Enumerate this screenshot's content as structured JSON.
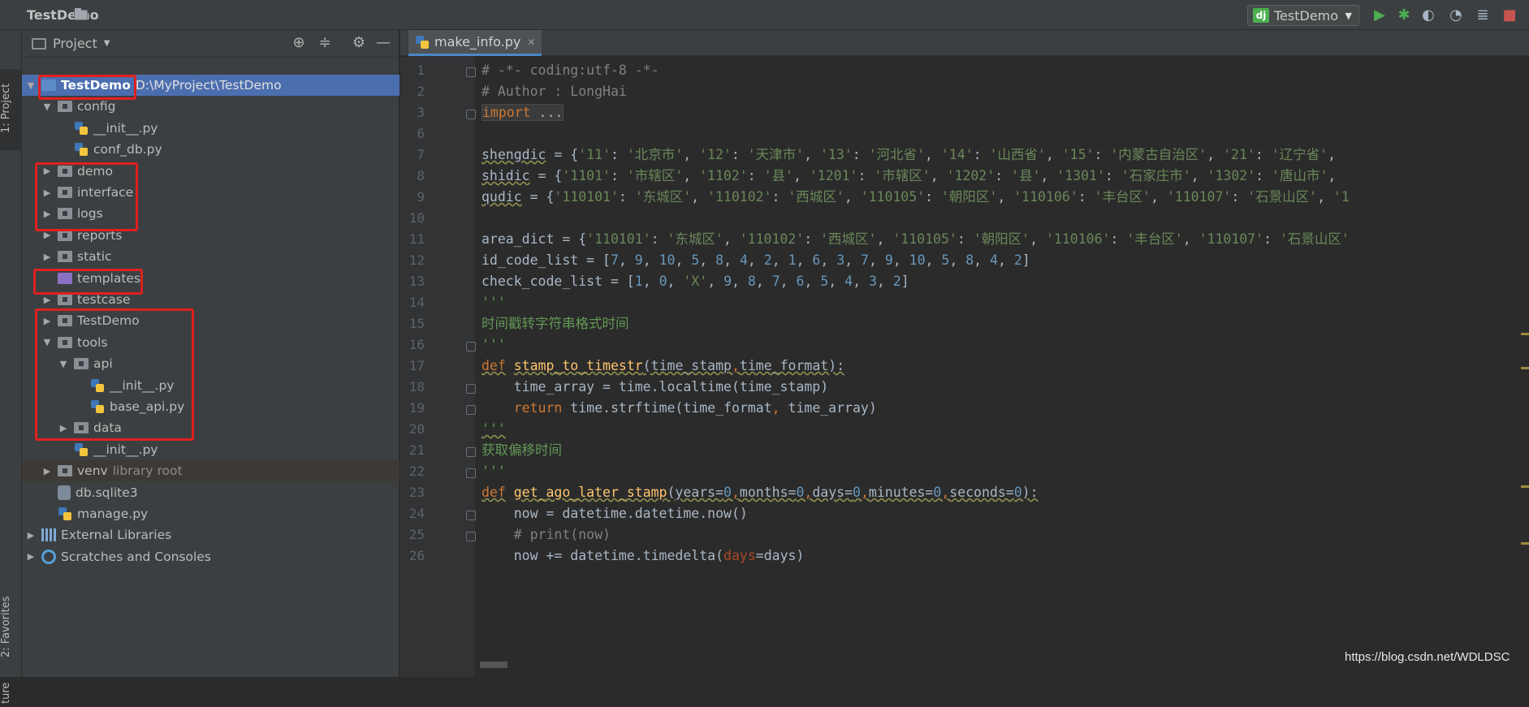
{
  "breadcrumb": {
    "project": "TestDemo"
  },
  "run_config": {
    "icon": "dj",
    "name": "TestDemo"
  },
  "toolbar": {
    "run": {
      "icon": "run-icon",
      "color": "#4caf50"
    },
    "debug": {
      "icon": "debug-icon",
      "color": "#4caf50"
    },
    "coverage": {
      "icon": "coverage-icon"
    },
    "profile": {
      "icon": "profile-icon"
    },
    "concurrency": {
      "icon": "concurrency-icon"
    },
    "stop": {
      "icon": "stop-icon",
      "color": "#c75450"
    }
  },
  "side_tabs": {
    "project": "1: Project",
    "favorites": "2: Favorites",
    "structure": "ture"
  },
  "project_panel": {
    "title": "Project",
    "tree": [
      {
        "label": "TestDemo",
        "sub": "D:\\MyProject\\TestDemo",
        "depth": 0,
        "open": true,
        "type": "module",
        "selected": true
      },
      {
        "label": "config",
        "depth": 1,
        "open": true,
        "type": "folder"
      },
      {
        "label": "__init__.py",
        "depth": 2,
        "type": "py"
      },
      {
        "label": "conf_db.py",
        "depth": 2,
        "type": "py"
      },
      {
        "label": "demo",
        "depth": 1,
        "open": false,
        "type": "folder"
      },
      {
        "label": "interface",
        "depth": 1,
        "open": false,
        "type": "folder"
      },
      {
        "label": "logs",
        "depth": 1,
        "open": false,
        "type": "folder"
      },
      {
        "label": "reports",
        "depth": 1,
        "open": false,
        "type": "folder"
      },
      {
        "label": "static",
        "depth": 1,
        "open": false,
        "type": "folder"
      },
      {
        "label": "templates",
        "depth": 1,
        "type": "template"
      },
      {
        "label": "testcase",
        "depth": 1,
        "open": false,
        "type": "folder"
      },
      {
        "label": "TestDemo",
        "depth": 1,
        "open": false,
        "type": "folder"
      },
      {
        "label": "tools",
        "depth": 1,
        "open": true,
        "type": "folder"
      },
      {
        "label": "api",
        "depth": 2,
        "open": true,
        "type": "folder"
      },
      {
        "label": "__init__.py",
        "depth": 3,
        "type": "py"
      },
      {
        "label": "base_api.py",
        "depth": 3,
        "type": "py"
      },
      {
        "label": "data",
        "depth": 2,
        "open": false,
        "type": "folder"
      },
      {
        "label": "__init__.py",
        "depth": 2,
        "type": "py"
      },
      {
        "label": "venv",
        "sub": "library root",
        "depth": 1,
        "open": false,
        "type": "folder",
        "venv": true
      },
      {
        "label": "db.sqlite3",
        "depth": 1,
        "type": "db"
      },
      {
        "label": "manage.py",
        "depth": 1,
        "type": "py"
      },
      {
        "label": "External Libraries",
        "depth": 0,
        "open": false,
        "type": "lib"
      },
      {
        "label": "Scratches and Consoles",
        "depth": 0,
        "open": false,
        "type": "scratch"
      }
    ]
  },
  "editor": {
    "tab": "make_info.py",
    "lines": [
      {
        "n": "1",
        "html": "<span class=\"c-com\"># -*- coding:utf-8 -*-</span>"
      },
      {
        "n": "2",
        "html": "<span class=\"c-com\"># Author : LongHai</span>"
      },
      {
        "n": "3",
        "html": "<span class=\"imp\"><span class=\"c-kw\">import</span> ...</span>"
      },
      {
        "n": "6",
        "html": ""
      },
      {
        "n": "7",
        "html": "<span class=\"wavy\">shengdic</span> = {<span class=\"c-str\">'11'</span>: <span class=\"c-str\">'北京市'</span>, <span class=\"c-str\">'12'</span>: <span class=\"c-str\">'天津市'</span>, <span class=\"c-str\">'13'</span>: <span class=\"c-str\">'河北省'</span>, <span class=\"c-str\">'14'</span>: <span class=\"c-str\">'山西省'</span>, <span class=\"c-str\">'15'</span>: <span class=\"c-str\">'内蒙古自治区'</span>, <span class=\"c-str\">'21'</span>: <span class=\"c-str\">'辽宁省'</span>,"
      },
      {
        "n": "8",
        "html": "<span class=\"wavy\">shidic</span> = {<span class=\"c-str\">'1101'</span>: <span class=\"c-str\">'市辖区'</span>, <span class=\"c-str\">'1102'</span>: <span class=\"c-str\">'县'</span>, <span class=\"c-str\">'1201'</span>: <span class=\"c-str\">'市辖区'</span>, <span class=\"c-str\">'1202'</span>: <span class=\"c-str\">'县'</span>, <span class=\"c-str\">'1301'</span>: <span class=\"c-str\">'石家庄市'</span>, <span class=\"c-str\">'1302'</span>: <span class=\"c-str\">'唐山市'</span>,"
      },
      {
        "n": "9",
        "html": "<span class=\"wavy\">qudic</span> = {<span class=\"c-str\">'110101'</span>: <span class=\"c-str\">'东城区'</span>, <span class=\"c-str\">'110102'</span>: <span class=\"c-str\">'西城区'</span>, <span class=\"c-str\">'110105'</span>: <span class=\"c-str\">'朝阳区'</span>, <span class=\"c-str\">'110106'</span>: <span class=\"c-str\">'丰台区'</span>, <span class=\"c-str\">'110107'</span>: <span class=\"c-str\">'石景山区'</span>, <span class=\"c-str\">'1</span>"
      },
      {
        "n": "10",
        "html": ""
      },
      {
        "n": "11",
        "html": "area_dict = {<span class=\"c-str\">'110101'</span>: <span class=\"c-str\">'东城区'</span>, <span class=\"c-str\">'110102'</span>: <span class=\"c-str\">'西城区'</span>, <span class=\"c-str\">'110105'</span>: <span class=\"c-str\">'朝阳区'</span>, <span class=\"c-str\">'110106'</span>: <span class=\"c-str\">'丰台区'</span>, <span class=\"c-str\">'110107'</span>: <span class=\"c-str\">'石景山区'</span>"
      },
      {
        "n": "12",
        "html": "id_code_list = [<span class=\"c-num\">7</span>, <span class=\"c-num\">9</span>, <span class=\"c-num\">10</span>, <span class=\"c-num\">5</span>, <span class=\"c-num\">8</span>, <span class=\"c-num\">4</span>, <span class=\"c-num\">2</span>, <span class=\"c-num\">1</span>, <span class=\"c-num\">6</span>, <span class=\"c-num\">3</span>, <span class=\"c-num\">7</span>, <span class=\"c-num\">9</span>, <span class=\"c-num\">10</span>, <span class=\"c-num\">5</span>, <span class=\"c-num\">8</span>, <span class=\"c-num\">4</span>, <span class=\"c-num\">2</span>]"
      },
      {
        "n": "13",
        "html": "check_code_list = [<span class=\"c-num\">1</span>, <span class=\"c-num\">0</span>, <span class=\"c-str\">'X'</span>, <span class=\"c-num\">9</span>, <span class=\"c-num\">8</span>, <span class=\"c-num\">7</span>, <span class=\"c-num\">6</span>, <span class=\"c-num\">5</span>, <span class=\"c-num\">4</span>, <span class=\"c-num\">3</span>, <span class=\"c-num\">2</span>]"
      },
      {
        "n": "14",
        "html": "<span class=\"c-doc\">'''</span>"
      },
      {
        "n": "15",
        "html": "<span class=\"c-doc\">时间戳转字符串格式时间</span>"
      },
      {
        "n": "16",
        "html": "<span class=\"c-doc\">'''</span>"
      },
      {
        "n": "17",
        "html": "<span class=\"c-kw wavy\">def</span> <span class=\"c-fn wavy\">stamp_to_timestr</span><span class=\"wavy\">(time_stamp</span><span class=\"c-kw wavy\">,</span><span class=\"wavy\">time_format):</span>"
      },
      {
        "n": "18",
        "html": "    time_array = time.localtime(time_stamp)"
      },
      {
        "n": "19",
        "html": "    <span class=\"c-kw\">return</span> time.strftime(time_format<span class=\"c-kw\">,</span> time_array)"
      },
      {
        "n": "20",
        "html": "<span class=\"c-doc wavy\">'''</span>"
      },
      {
        "n": "21",
        "html": "<span class=\"c-doc\">获取偏移时间</span>"
      },
      {
        "n": "22",
        "html": "<span class=\"c-doc\">'''</span>"
      },
      {
        "n": "23",
        "html": "<span class=\"c-kw wavy\">def</span> <span class=\"c-fn wavy\">get_ago_later_stamp</span><span class=\"wavy\">(years=</span><span class=\"c-num wavy\">0</span><span class=\"c-kw wavy\">,</span><span class=\"wavy\">months=</span><span class=\"c-num wavy\">0</span><span class=\"c-kw wavy\">,</span><span class=\"wavy\">days=</span><span class=\"c-num wavy\">0</span><span class=\"c-kw wavy\">,</span><span class=\"wavy\">minutes=</span><span class=\"c-num wavy\">0</span><span class=\"c-kw wavy\">,</span><span class=\"wavy\">seconds=</span><span class=\"c-num wavy\">0</span><span class=\"wavy\">):</span>"
      },
      {
        "n": "24",
        "html": "    now = datetime.datetime.now()"
      },
      {
        "n": "25",
        "html": "    <span class=\"c-com\"># print(now)</span>"
      },
      {
        "n": "26",
        "html": "    now += datetime.timedelta(<span class=\"c-nm\">days</span>=days)"
      }
    ]
  },
  "watermark": "https://blog.csdn.net/WDLDSC"
}
